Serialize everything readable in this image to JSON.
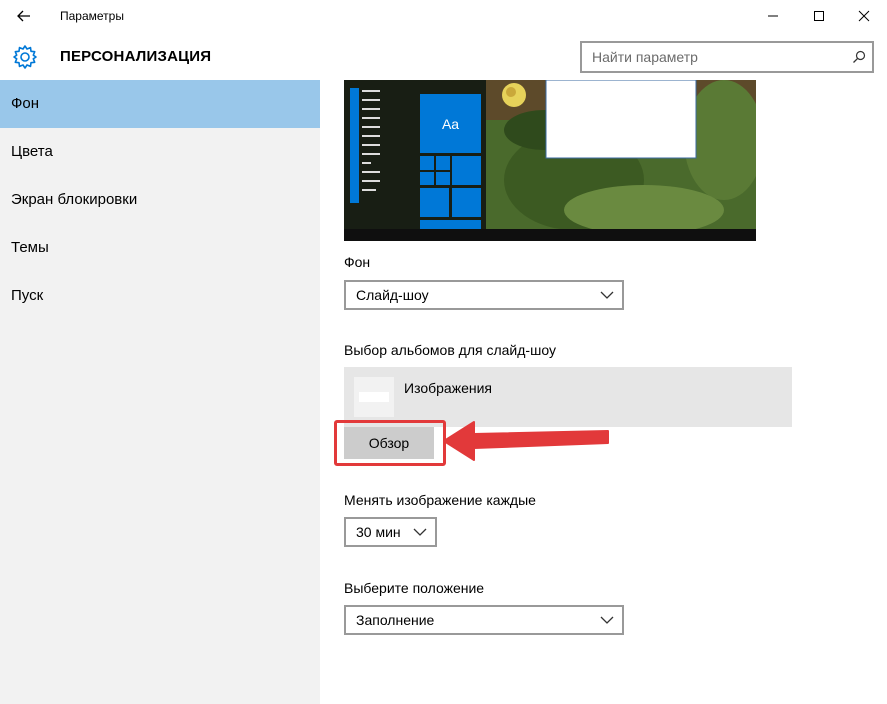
{
  "window": {
    "title": "Параметры",
    "back_icon": "arrow-left-icon",
    "minimize_icon": "minimize-icon",
    "maximize_icon": "maximize-icon",
    "close_icon": "close-icon"
  },
  "header": {
    "title": "ПЕРСОНАЛИЗАЦИЯ",
    "icon": "gear-icon",
    "search_placeholder": "Найти параметр",
    "search_icon": "search-icon"
  },
  "sidebar": {
    "items": [
      {
        "label": "Фон",
        "active": true
      },
      {
        "label": "Цвета",
        "active": false
      },
      {
        "label": "Экран блокировки",
        "active": false
      },
      {
        "label": "Темы",
        "active": false
      },
      {
        "label": "Пуск",
        "active": false
      }
    ]
  },
  "preview": {
    "tile_label": "Aa"
  },
  "background": {
    "label": "Фон",
    "value": "Слайд-шоу"
  },
  "albums": {
    "label": "Выбор альбомов для слайд-шоу",
    "items": [
      {
        "name": "Изображения"
      }
    ],
    "browse_label": "Обзор"
  },
  "interval": {
    "label": "Менять изображение каждые",
    "value": "30 мин"
  },
  "position": {
    "label": "Выберите положение",
    "value": "Заполнение"
  },
  "colors": {
    "accent": "#0078d7",
    "sidebar_active": "#99c7ea",
    "highlight": "#e2393a"
  }
}
